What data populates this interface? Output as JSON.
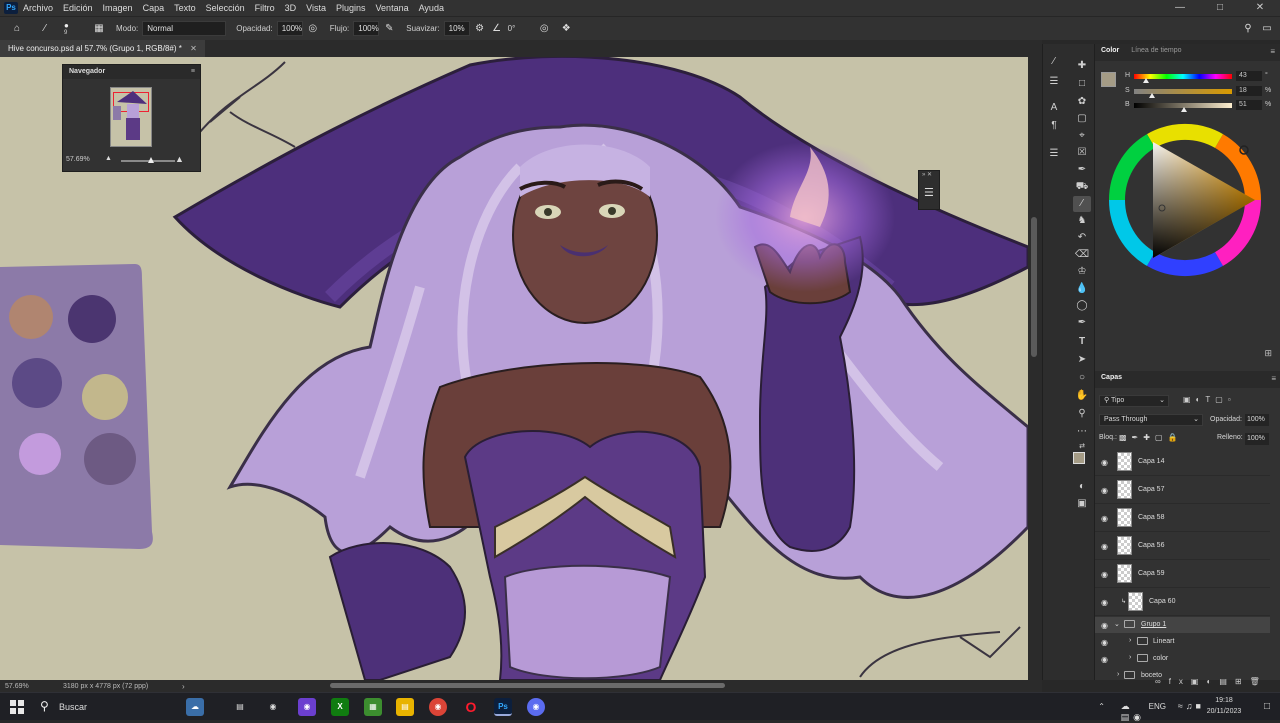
{
  "menubar": {
    "logo": "Ps",
    "items": [
      "Archivo",
      "Edición",
      "Imagen",
      "Capa",
      "Texto",
      "Selección",
      "Filtro",
      "3D",
      "Vista",
      "Plugins",
      "Ventana",
      "Ayuda"
    ]
  },
  "options": {
    "brush_size": "9",
    "mode_label": "Modo:",
    "mode_value": "Normal",
    "opacity_label": "Opacidad:",
    "opacity_value": "100%",
    "flow_label": "Flujo:",
    "flow_value": "100%",
    "smooth_label": "Suavizar:",
    "smooth_value": "10%",
    "angle_value": "0°"
  },
  "document": {
    "tab_title": "Hive concurso.psd al 57.7% (Grupo 1, RGB/8#) *",
    "status_zoom": "57.69%",
    "status_size": "3180 px x 4778 px (72 ppp)"
  },
  "navigator": {
    "title": "Navegador",
    "zoom": "57.69%",
    "zoom_fraction": 0.55
  },
  "color_panel": {
    "tabs": [
      "Color",
      "Línea de tiempo"
    ],
    "h": {
      "label": "H",
      "value": "43",
      "unit": "°",
      "fraction": 0.12
    },
    "s": {
      "label": "S",
      "value": "18",
      "unit": "%",
      "fraction": 0.18
    },
    "b": {
      "label": "B",
      "value": "51",
      "unit": "%",
      "fraction": 0.51
    },
    "foreground_color": "#a59c86",
    "background_color": "#ffffff"
  },
  "swatches": [
    "#b08570",
    "#4b3570",
    "#5c4a86",
    "#c2b78c",
    "#c39bdd",
    "#6d5a83"
  ],
  "layers_panel": {
    "title": "Capas",
    "filter_label": "Tipo",
    "blend_mode": "Pass Through",
    "opacity_label": "Opacidad:",
    "opacity_value": "100%",
    "lock_label": "Bloq.:",
    "fill_label": "Relleno:",
    "fill_value": "100%",
    "layers": [
      "Capa 14",
      "Capa 57",
      "Capa 58",
      "Capa 56",
      "Capa 59",
      "Capa 60"
    ],
    "groups": [
      {
        "name": "Grupo 1",
        "level": 0,
        "selected": true
      },
      {
        "name": "Lineart",
        "level": 1,
        "selected": false
      },
      {
        "name": "color",
        "level": 1,
        "selected": false
      },
      {
        "name": "boceto",
        "level": 0,
        "selected": false
      }
    ]
  },
  "taskbar": {
    "search": "Buscar",
    "lang": "ENG",
    "time": "19:18",
    "date": "20/11/2023",
    "ps_label": "Ps"
  }
}
